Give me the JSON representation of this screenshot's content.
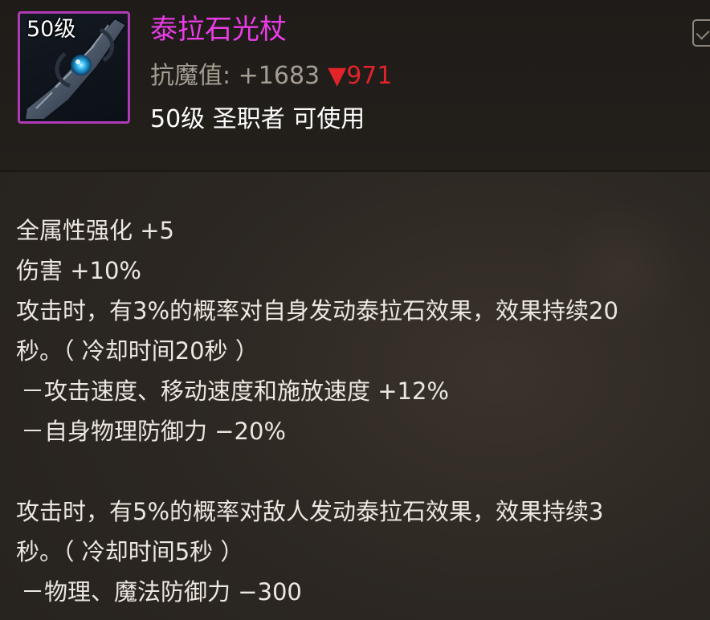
{
  "item": {
    "level_tag": "50级",
    "name": "泰拉石光杖",
    "stat_label": "抗魔值:",
    "stat_value": "+1683",
    "stat_diff": "▼971",
    "requirement": "50级 圣职者 可使用",
    "icon": "staff-icon"
  },
  "description": {
    "lines": [
      "全属性强化 +5",
      "伤害 +10%",
      "攻击时，有3%的概率对自身发动泰拉石效果，效果持续20",
      "秒。（ 冷却时间20秒 ）",
      "－攻击速度、移动速度和施放速度 +12%",
      "－自身物理防御力 −20%",
      "",
      "攻击时，有5%的概率对敌人发动泰拉石效果，效果持续3",
      "秒。（ 冷却时间5秒 ）",
      "－物理、魔法防御力 −300"
    ]
  },
  "colors": {
    "name": "#e93de6",
    "frame": "#b03ab4",
    "decrease": "#e2242a",
    "stat": "#a59d93"
  }
}
